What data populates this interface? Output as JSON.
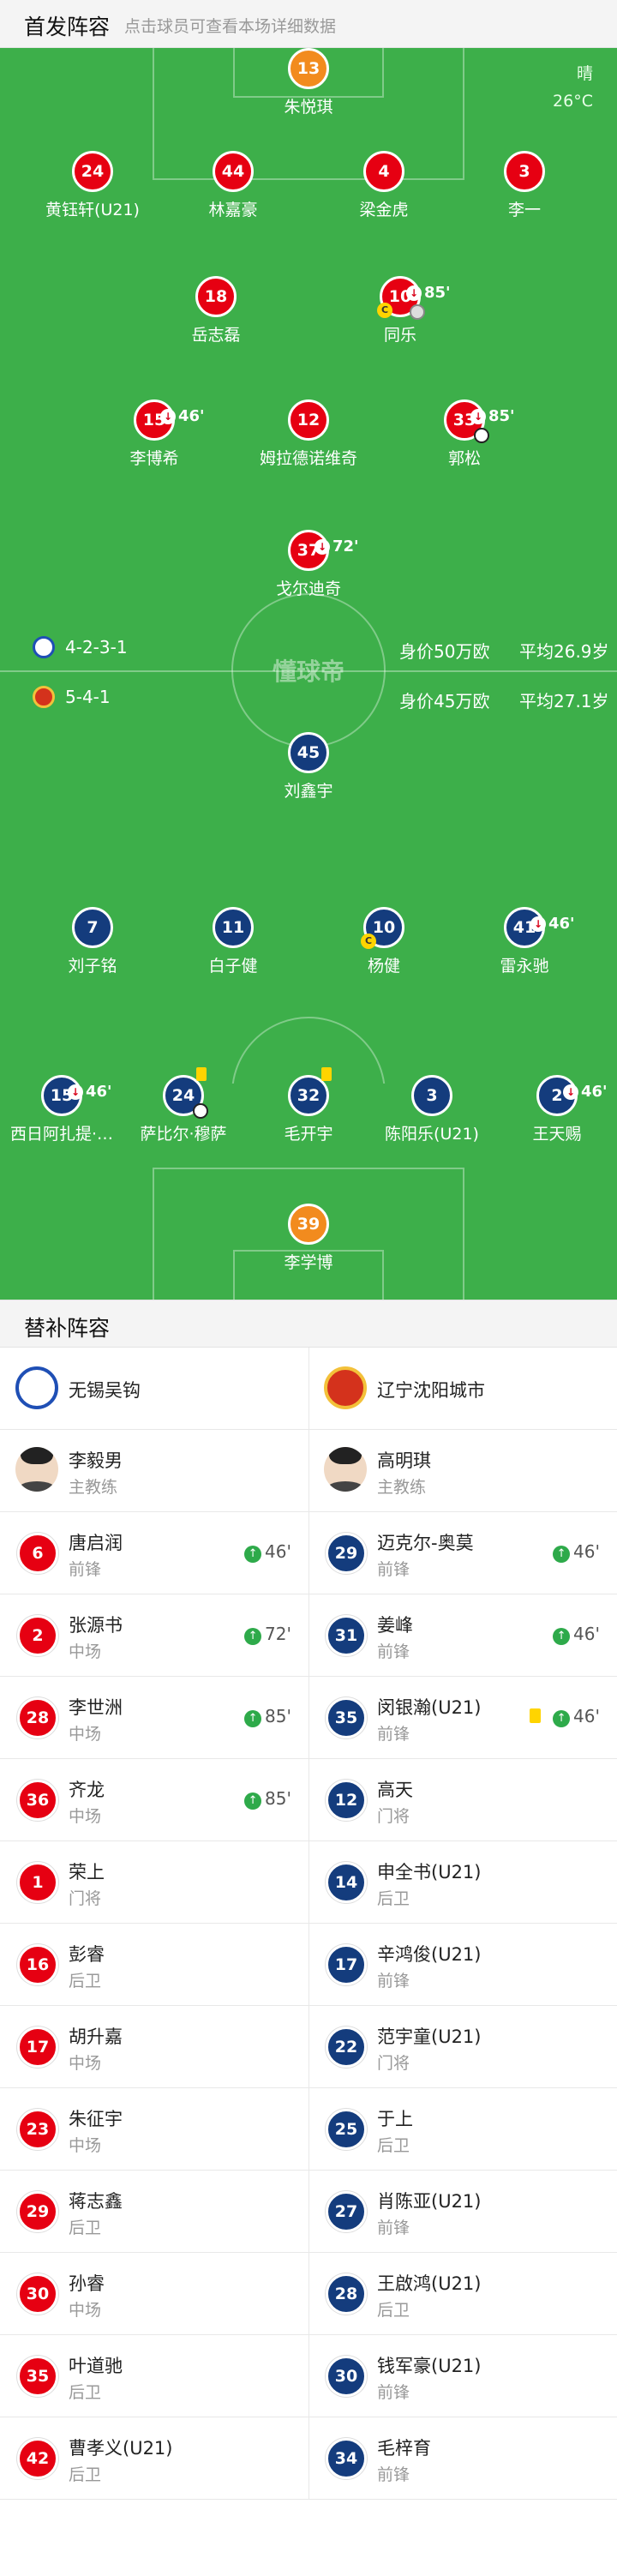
{
  "header": {
    "title": "首发阵容",
    "subtitle": "点击球员可查看本场详细数据"
  },
  "weather": {
    "condition": "晴",
    "temp": "26°C"
  },
  "watermark": "懂球帝",
  "home_team": {
    "formation": "4-2-3-1",
    "value": "身价50万欧",
    "avg_age": "平均26.9岁"
  },
  "away_team": {
    "formation": "5-4-1",
    "value": "身价45万欧",
    "avg_age": "平均27.1岁"
  },
  "lineup_away": [
    {
      "num": "13",
      "name": "朱悦琪"
    },
    {
      "num": "24",
      "name": "黄钰轩(U21)"
    },
    {
      "num": "44",
      "name": "林嘉豪"
    },
    {
      "num": "4",
      "name": "梁金虎"
    },
    {
      "num": "3",
      "name": "李一"
    },
    {
      "num": "18",
      "name": "岳志磊"
    },
    {
      "num": "10",
      "name": "同乐",
      "sub": "85'"
    },
    {
      "num": "15",
      "name": "李博希",
      "sub": "46'"
    },
    {
      "num": "12",
      "name": "姆拉德诺维奇"
    },
    {
      "num": "33",
      "name": "郭松",
      "sub": "85'"
    },
    {
      "num": "37",
      "name": "戈尔迪奇",
      "sub": "72'"
    }
  ],
  "lineup_home": [
    {
      "num": "45",
      "name": "刘鑫宇"
    },
    {
      "num": "7",
      "name": "刘子铭"
    },
    {
      "num": "11",
      "name": "白子健"
    },
    {
      "num": "10",
      "name": "杨健"
    },
    {
      "num": "41",
      "name": "雷永驰",
      "sub": "46'"
    },
    {
      "num": "15",
      "name": "西日阿扎提·…",
      "sub": "46'"
    },
    {
      "num": "24",
      "name": "萨比尔·穆萨"
    },
    {
      "num": "32",
      "name": "毛开宇"
    },
    {
      "num": "3",
      "name": "陈阳乐(U21)"
    },
    {
      "num": "2",
      "name": "王天赐",
      "sub": "46'"
    },
    {
      "num": "39",
      "name": "李学博"
    }
  ],
  "subs_title": "替补阵容",
  "subs_left": {
    "team": "无锡吴钩",
    "coach": {
      "name": "李毅男",
      "role": "主教练"
    },
    "players": [
      {
        "num": "6",
        "name": "唐启润",
        "pos": "前锋",
        "in": "46'"
      },
      {
        "num": "2",
        "name": "张源书",
        "pos": "中场",
        "in": "72'"
      },
      {
        "num": "28",
        "name": "李世洲",
        "pos": "中场",
        "in": "85'"
      },
      {
        "num": "36",
        "name": "齐龙",
        "pos": "中场",
        "in": "85'"
      },
      {
        "num": "1",
        "name": "荣上",
        "pos": "门将"
      },
      {
        "num": "16",
        "name": "彭睿",
        "pos": "后卫"
      },
      {
        "num": "17",
        "name": "胡升嘉",
        "pos": "中场"
      },
      {
        "num": "23",
        "name": "朱征宇",
        "pos": "中场"
      },
      {
        "num": "29",
        "name": "蒋志鑫",
        "pos": "后卫"
      },
      {
        "num": "30",
        "name": "孙睿",
        "pos": "中场"
      },
      {
        "num": "35",
        "name": "叶道驰",
        "pos": "后卫"
      },
      {
        "num": "42",
        "name": "曹孝义(U21)",
        "pos": "后卫"
      }
    ]
  },
  "subs_right": {
    "team": "辽宁沈阳城市",
    "coach": {
      "name": "高明琪",
      "role": "主教练"
    },
    "players": [
      {
        "num": "29",
        "name": "迈克尔-奥莫",
        "pos": "前锋",
        "in": "46'"
      },
      {
        "num": "31",
        "name": "姜峰",
        "pos": "前锋",
        "in": "46'"
      },
      {
        "num": "35",
        "name": "闵银瀚(U21)",
        "pos": "前锋",
        "in": "46'"
      },
      {
        "num": "12",
        "name": "高天",
        "pos": "门将"
      },
      {
        "num": "14",
        "name": "申全书(U21)",
        "pos": "后卫"
      },
      {
        "num": "17",
        "name": "辛鸿俊(U21)",
        "pos": "前锋"
      },
      {
        "num": "22",
        "name": "范宇童(U21)",
        "pos": "门将"
      },
      {
        "num": "25",
        "name": "于上",
        "pos": "后卫"
      },
      {
        "num": "27",
        "name": "肖陈亚(U21)",
        "pos": "前锋"
      },
      {
        "num": "28",
        "name": "王啟鸿(U21)",
        "pos": "后卫"
      },
      {
        "num": "30",
        "name": "钱军豪(U21)",
        "pos": "前锋"
      },
      {
        "num": "34",
        "name": "毛梓育",
        "pos": "前锋"
      }
    ]
  },
  "colors": {
    "pitch": "#3daf4a",
    "away_kit": "#e60012",
    "home_kit": "#143c7d",
    "goalkeeper": "#f28b1e",
    "sub_in": "#2eaa4a",
    "yellow_card": "#ffd400"
  }
}
